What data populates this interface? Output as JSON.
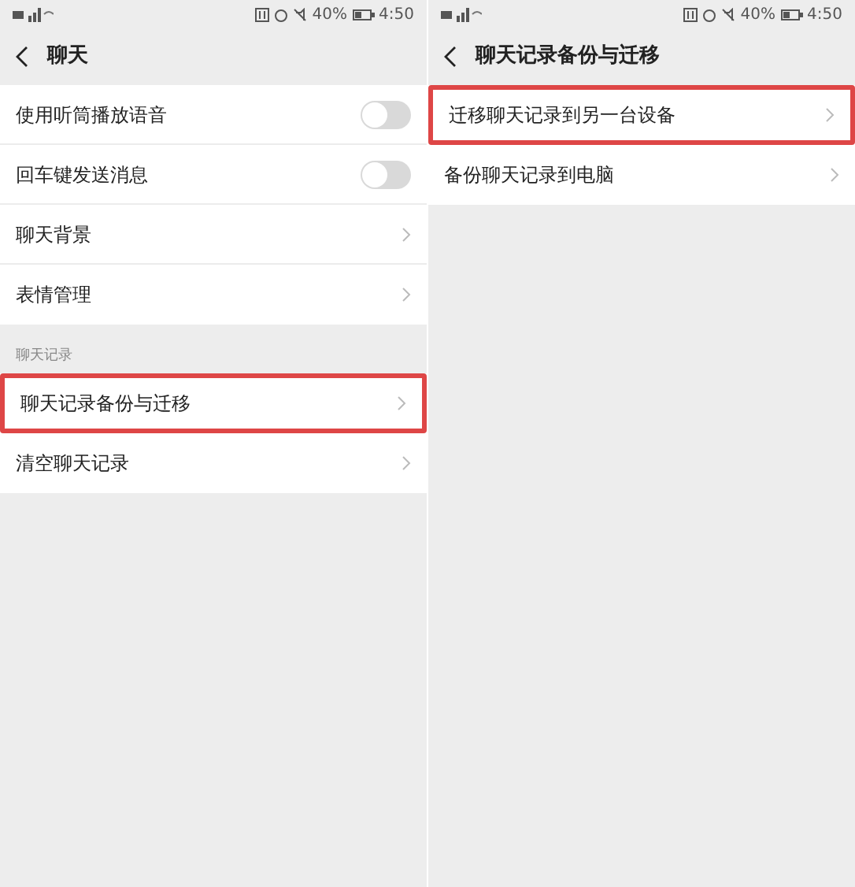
{
  "screens": [
    {
      "status": {
        "battery": "40%",
        "time": "4:50"
      },
      "title": "聊天",
      "sections": [
        {
          "items": [
            {
              "kind": "toggle",
              "label": "使用听筒播放语音",
              "on": false,
              "highlighted": false
            },
            {
              "kind": "toggle",
              "label": "回车键发送消息",
              "on": false,
              "highlighted": false
            },
            {
              "kind": "link",
              "label": "聊天背景",
              "highlighted": false
            },
            {
              "kind": "link",
              "label": "表情管理",
              "highlighted": false
            }
          ]
        },
        {
          "header": "聊天记录",
          "items": [
            {
              "kind": "link",
              "label": "聊天记录备份与迁移",
              "highlighted": true
            },
            {
              "kind": "link",
              "label": "清空聊天记录",
              "highlighted": false
            }
          ]
        }
      ]
    },
    {
      "status": {
        "battery": "40%",
        "time": "4:50"
      },
      "title": "聊天记录备份与迁移",
      "sections": [
        {
          "items": [
            {
              "kind": "link",
              "label": "迁移聊天记录到另一台设备",
              "highlighted": true
            },
            {
              "kind": "link",
              "label": "备份聊天记录到电脑",
              "highlighted": false
            }
          ]
        }
      ]
    }
  ]
}
